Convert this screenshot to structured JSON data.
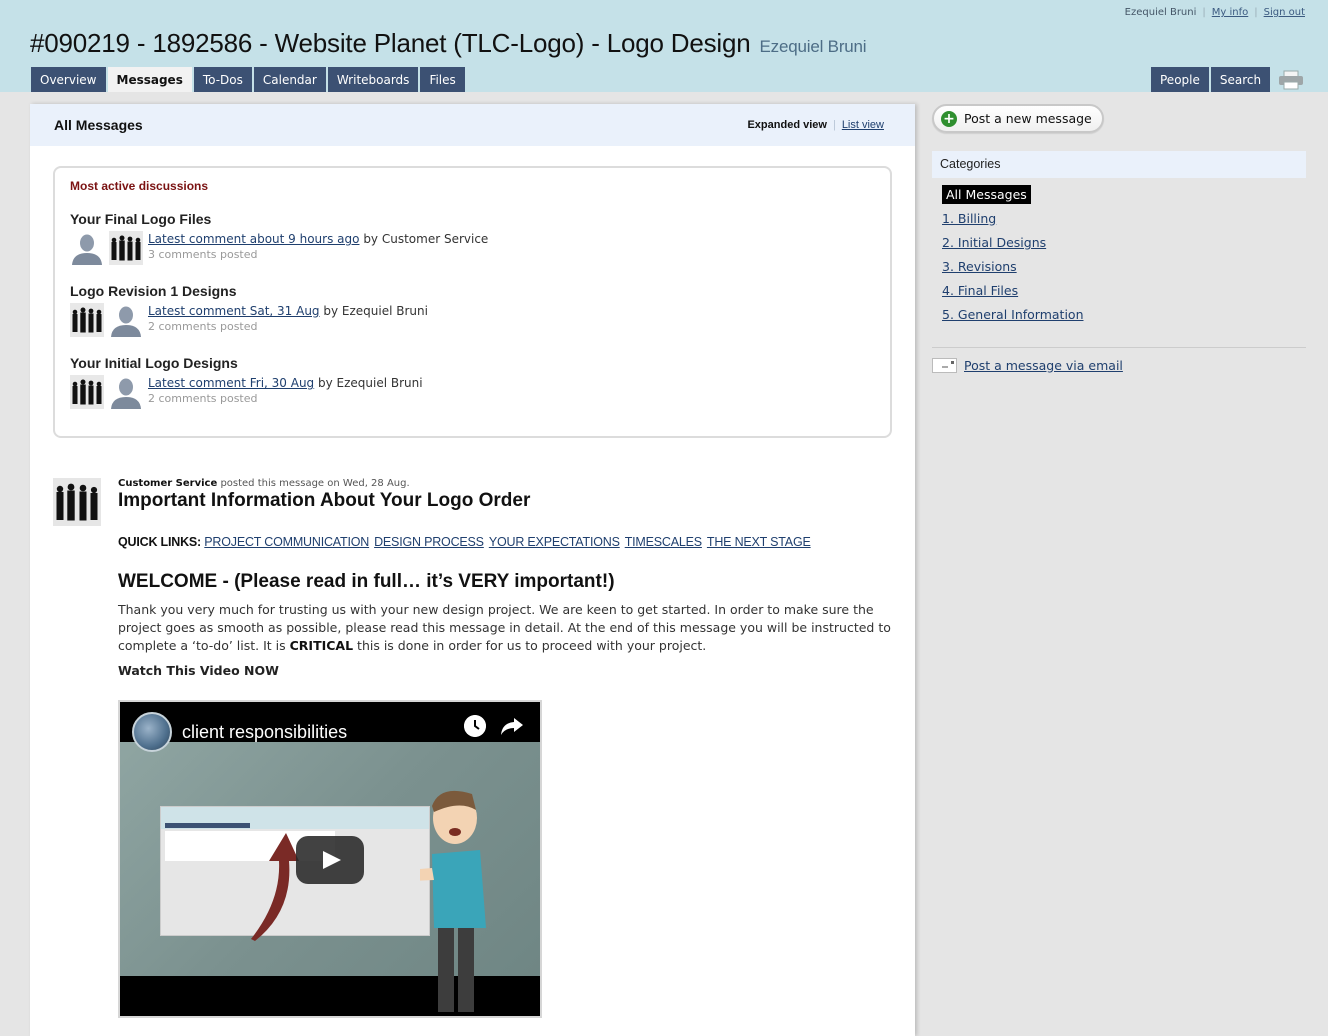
{
  "header": {
    "user_name": "Ezequiel Bruni",
    "my_info": "My info",
    "sign_out": "Sign out",
    "project_title": "#090219 - 1892586 - Website Planet (TLC-Logo) - Logo Design",
    "project_owner": "Ezequiel Bruni",
    "tabs": [
      {
        "label": "Overview",
        "active": false
      },
      {
        "label": "Messages",
        "active": true
      },
      {
        "label": "To-Dos",
        "active": false
      },
      {
        "label": "Calendar",
        "active": false
      },
      {
        "label": "Writeboards",
        "active": false
      },
      {
        "label": "Files",
        "active": false
      }
    ],
    "right_tabs": [
      {
        "label": "People"
      },
      {
        "label": "Search"
      }
    ],
    "print_icon": "printer-icon",
    "colors": {
      "header_bg": "#c5e1e8",
      "tab_bg": "#3c5173"
    }
  },
  "main": {
    "title": "All Messages",
    "view_expanded": "Expanded view",
    "view_list": "List view",
    "discussions": {
      "heading": "Most active discussions",
      "items": [
        {
          "title": "Your Final Logo Files",
          "latest_link": "Latest comment about 9 hours ago",
          "by": "by Customer Service",
          "count": "3 comments posted",
          "avatars": [
            "generic-user-avatar",
            "group-silhouette-avatar"
          ]
        },
        {
          "title": "Logo Revision 1 Designs",
          "latest_link": "Latest comment Sat, 31 Aug",
          "by": "by Ezequiel Bruni",
          "count": "2 comments posted",
          "avatars": [
            "group-silhouette-avatar",
            "generic-user-avatar"
          ]
        },
        {
          "title": "Your Initial Logo Designs",
          "latest_link": "Latest comment Fri, 30 Aug",
          "by": "by Ezequiel Bruni",
          "count": "2 comments posted",
          "avatars": [
            "group-silhouette-avatar",
            "generic-user-avatar"
          ]
        }
      ]
    },
    "message": {
      "author": "Customer Service",
      "posted_text": "posted this message on Wed, 28 Aug.",
      "title": "Important Information About Your Logo Order",
      "quick_links_label": "QUICK LINKS:",
      "quick_links": [
        "PROJECT COMMUNICATION",
        "DESIGN PROCESS",
        "YOUR EXPECTATIONS",
        "TIMESCALES",
        "THE NEXT STAGE"
      ],
      "welcome": "WELCOME - (Please read in full… it’s VERY important!)",
      "intro_before": "Thank you very much for trusting us with your new design project. We are keen to get started. In order to make sure the project goes as smooth as possible, please read this message in detail. At the end of this message you will be instructed to complete a ‘to-do’ list. It is ",
      "intro_bold": "CRITICAL",
      "intro_after": " this is done in order for us to proceed with your project.",
      "watch_label": "Watch This Video NOW",
      "video": {
        "title": "client responsibilities",
        "icons": [
          "watch-later-icon",
          "share-icon",
          "play-icon"
        ]
      }
    }
  },
  "sidebar": {
    "post_button": "Post a new message",
    "categories_heading": "Categories",
    "categories": [
      {
        "label": "All Messages",
        "active": true
      },
      {
        "label": "1. Billing",
        "active": false
      },
      {
        "label": "2. Initial Designs",
        "active": false
      },
      {
        "label": "3. Revisions",
        "active": false
      },
      {
        "label": "4. Final Files",
        "active": false
      },
      {
        "label": "5. General Information",
        "active": false
      }
    ],
    "email_link": "Post a message via email"
  }
}
